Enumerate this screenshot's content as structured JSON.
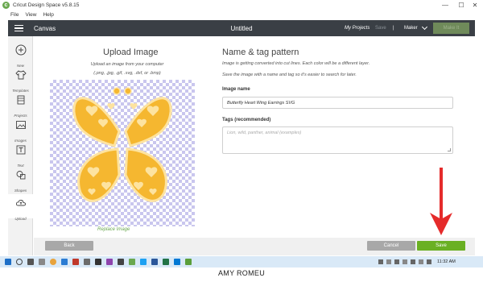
{
  "window": {
    "title": "Cricut Design Space  v5.8.15",
    "controls": {
      "minimize": "—",
      "maximize": "☐",
      "close": "✕"
    }
  },
  "menubar": {
    "items": [
      "File",
      "View",
      "Help"
    ]
  },
  "appbar": {
    "canvas_label": "Canvas",
    "document_title": "Untitled",
    "my_projects": "My Projects",
    "save": "Save",
    "separator": "|",
    "machine": "Maker",
    "make_it": "Make It"
  },
  "sidebar": {
    "items": [
      {
        "label": "New",
        "icon": "plus-icon"
      },
      {
        "label": "Templates",
        "icon": "shirt-icon"
      },
      {
        "label": "Projects",
        "icon": "grid-icon"
      },
      {
        "label": "Images",
        "icon": "image-icon"
      },
      {
        "label": "Text",
        "icon": "text-icon"
      },
      {
        "label": "Shapes",
        "icon": "shapes-icon"
      },
      {
        "label": "Upload",
        "icon": "upload-cloud-icon",
        "active": true
      }
    ]
  },
  "upload": {
    "title": "Upload Image",
    "description": "Upload an image from your computer",
    "formats": "(.png, .jpg, .gif, .svg, .dxf, or .bmp)",
    "replace_link": "Replace Image"
  },
  "name_tag": {
    "title": "Name & tag pattern",
    "info_line1": "Image is getting converted into cut lines. Each color will be a different layer.",
    "info_line2": "Save the image with a name and tag so it's easier to search for later.",
    "name_label": "Image name",
    "name_value": "Butterfly Heart Wing Earrings SVG",
    "tags_label": "Tags (recommended)",
    "tags_placeholder": "Lion, wild, panther, animal (examples)"
  },
  "actions": {
    "back": "Back",
    "cancel": "Cancel",
    "save": "Save"
  },
  "taskbar": {
    "time": "11:32 AM"
  },
  "caption": "AMY ROMEU",
  "colors": {
    "appbar": "#3a3f45",
    "accent_green": "#6ab023",
    "link_green": "#6aa84f",
    "wing_outer": "#f5b730",
    "wing_inner": "#fde3a0",
    "arrow_red": "#e52b2b",
    "checker": "#c9c6ee"
  }
}
